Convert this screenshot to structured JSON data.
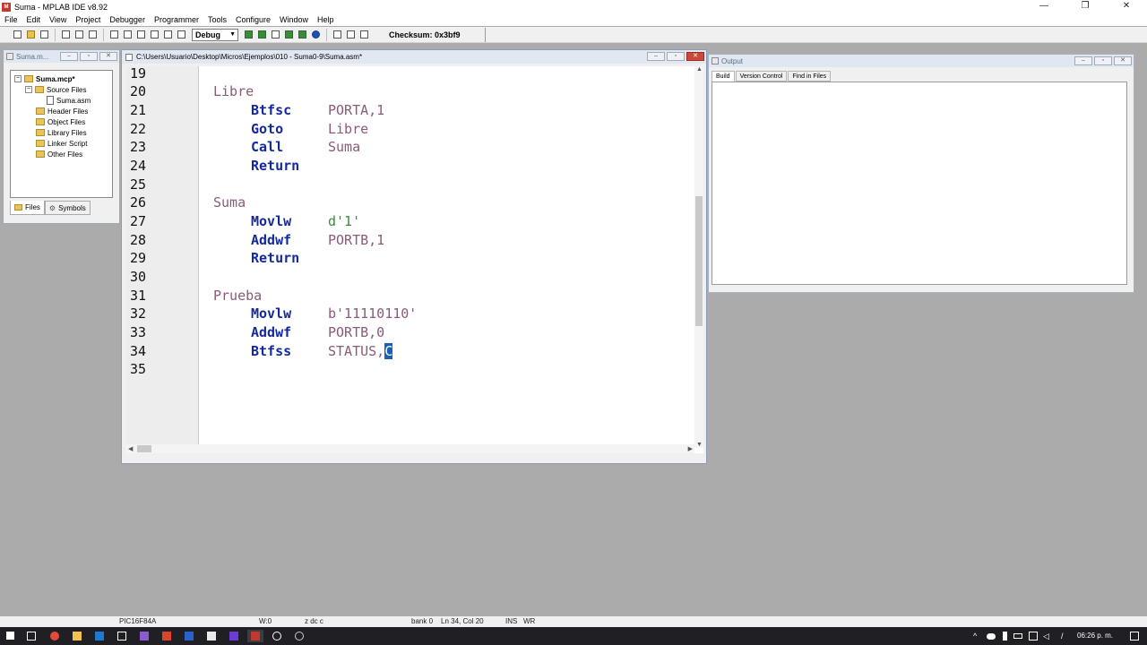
{
  "window": {
    "title": "Suma - MPLAB IDE v8.92",
    "icon_label": "M",
    "controls": [
      "—",
      "❐",
      "✕"
    ]
  },
  "menu": [
    "File",
    "Edit",
    "View",
    "Project",
    "Debugger",
    "Programmer",
    "Tools",
    "Configure",
    "Window",
    "Help"
  ],
  "toolbar": {
    "config": "Debug",
    "checksum_label": "Checksum:",
    "checksum_value": "0x3bf9"
  },
  "project": {
    "title": "Suma.m...",
    "root": "Suma.mcp*",
    "source_folder": "Source Files",
    "source_file": "Suma.asm",
    "folders": [
      "Header Files",
      "Object Files",
      "Library Files",
      "Linker Script",
      "Other Files"
    ],
    "tabs": [
      "Files",
      "Symbols"
    ]
  },
  "editor": {
    "title": "C:\\Users\\Usuario\\Desktop\\Micros\\Ejemplos\\010 - Suma0-9\\Suma.asm*",
    "line_numbers": [
      "19",
      "20",
      "21",
      "22",
      "23",
      "24",
      "25",
      "26",
      "27",
      "28",
      "29",
      "30",
      "31",
      "32",
      "33",
      "34",
      "35"
    ],
    "code": {
      "l20_label": "Libre",
      "l21_op": "Btfsc",
      "l21_arg": "PORTA,1",
      "l22_op": "Goto",
      "l22_arg": "Libre",
      "l23_op": "Call",
      "l23_arg": "Suma",
      "l24_op": "Return",
      "l26_label": "Suma",
      "l27_op": "Movlw",
      "l27_arg": "d'1'",
      "l28_op": "Addwf",
      "l28_arg": "PORTB,1",
      "l29_op": "Return",
      "l31_label": "Prueba",
      "l32_op": "Movlw",
      "l32_arg": "b'11110110'",
      "l33_op": "Addwf",
      "l33_arg": "PORTB,0",
      "l34_op": "Btfss",
      "l34_arg": "STATUS,",
      "l34_sel": "C"
    }
  },
  "output": {
    "title": "Output",
    "tabs": [
      "Build",
      "Version Control",
      "Find in Files"
    ]
  },
  "status": {
    "device": "PIC16F84A",
    "w": "W:0",
    "flags": "z dc c",
    "bank": "bank 0",
    "position": "Ln 34, Col 20",
    "ins": "INS",
    "wr": "WR"
  },
  "taskbar": {
    "time": "06:26 p. m."
  }
}
